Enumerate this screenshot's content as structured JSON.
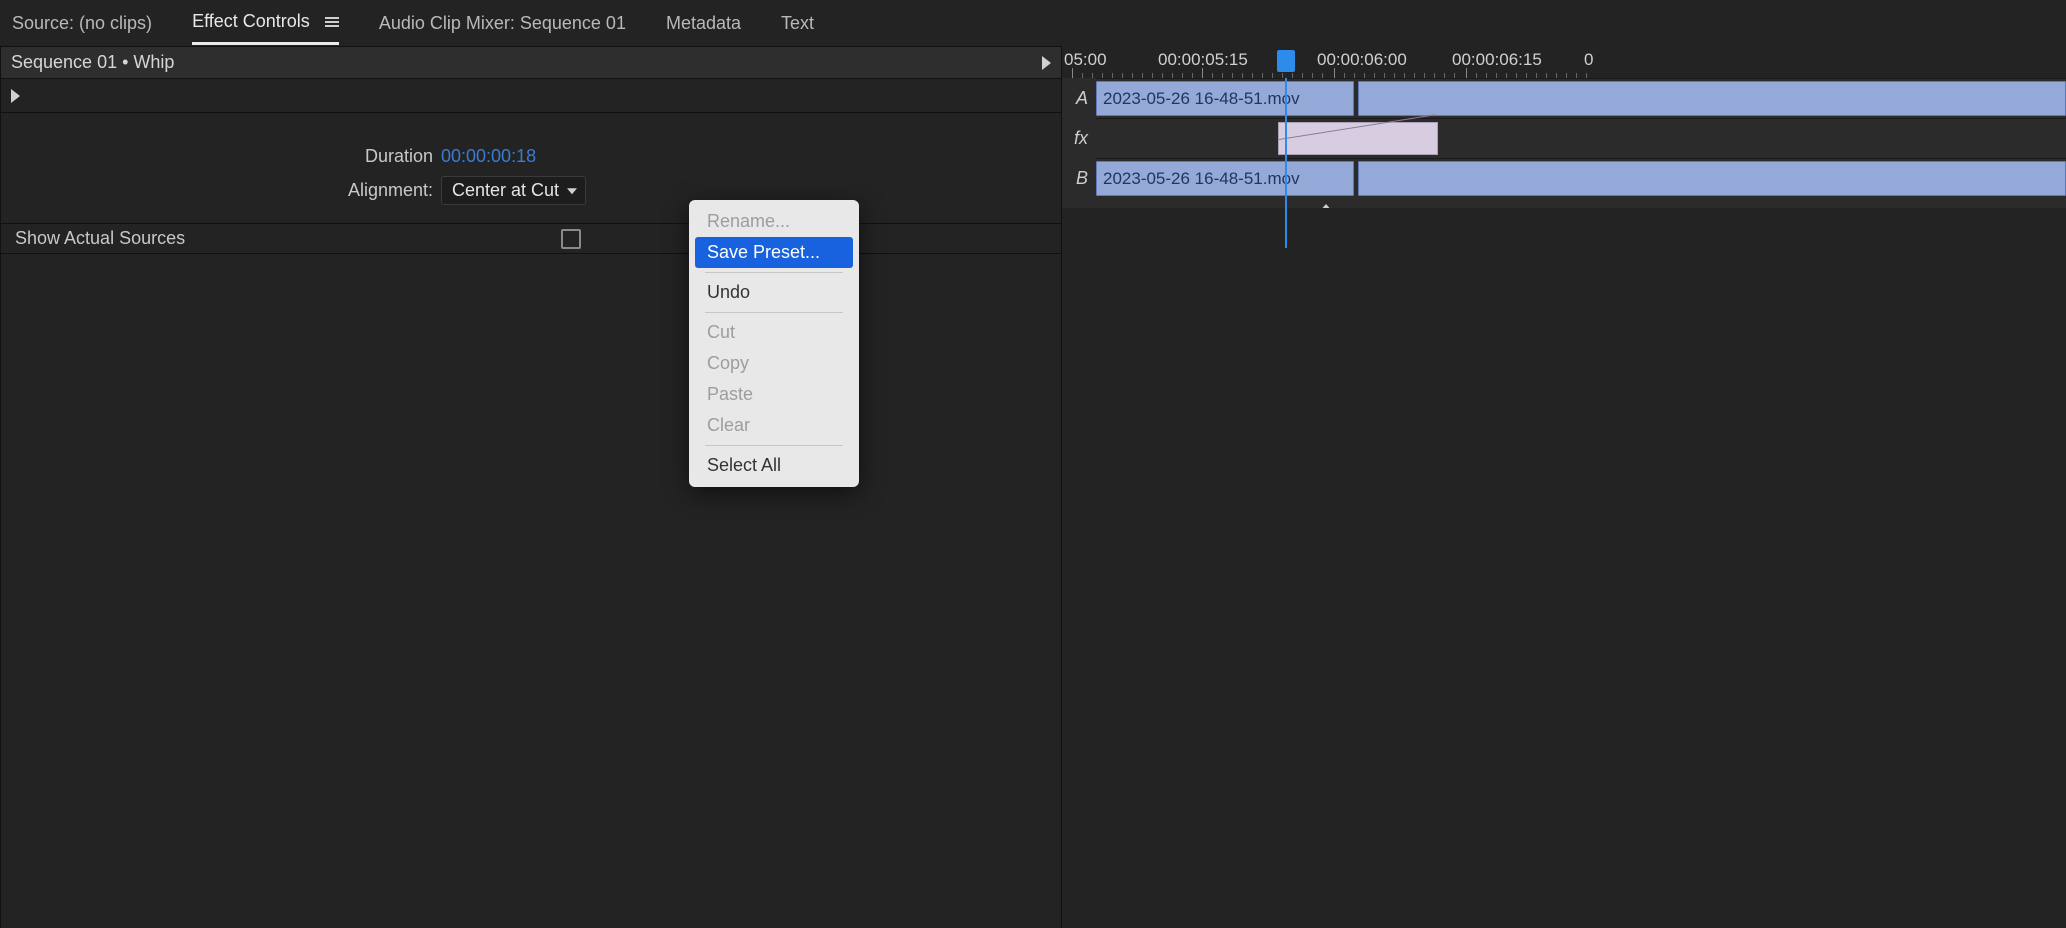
{
  "tabs": {
    "source": "Source: (no clips)",
    "effect_controls": "Effect Controls",
    "audio_mixer": "Audio Clip Mixer: Sequence 01",
    "metadata": "Metadata",
    "text": "Text"
  },
  "sequence_header": "Sequence 01 • Whip",
  "props": {
    "duration_label": "Duration",
    "duration_value": "00:00:00:18",
    "alignment_label": "Alignment:",
    "alignment_value": "Center at Cut"
  },
  "show_actual_sources": "Show Actual Sources",
  "context_menu": {
    "rename": "Rename...",
    "save_preset": "Save Preset...",
    "undo": "Undo",
    "cut": "Cut",
    "copy": "Copy",
    "paste": "Paste",
    "clear": "Clear",
    "select_all": "Select All"
  },
  "timecodes": [
    "05:00",
    "00:00:05:15",
    "00:00:06:00",
    "00:00:06:15",
    "0"
  ],
  "tracks": {
    "a": "A",
    "fx": "fx",
    "b": "B"
  },
  "clip_a": "2023-05-26 16-48-51.mov",
  "clip_b": "2023-05-26 16-48-51.mov"
}
